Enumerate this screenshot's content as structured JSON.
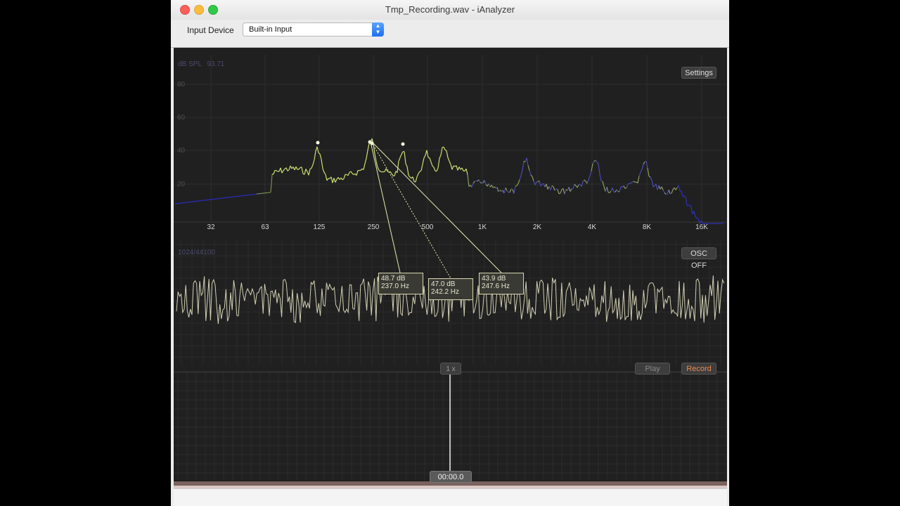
{
  "window": {
    "title": "Tmp_Recording.wav - iAnalyzer"
  },
  "toolbar": {
    "input_device_label": "Input Device",
    "input_device_value": "Built-in Input"
  },
  "spectrum": {
    "scale_label": "dB SPL",
    "spl_value": "93.71",
    "y_ticks": [
      "80",
      "60",
      "40",
      "20"
    ],
    "x_ticks": [
      "32",
      "63",
      "125",
      "250",
      "500",
      "1K",
      "2K",
      "4K",
      "8K",
      "16K"
    ],
    "settings_label": "Settings",
    "peaks": [
      {
        "db": "48.7 dB",
        "hz": "237.0 Hz"
      },
      {
        "db": "47.0 dB",
        "hz": "242.2 Hz"
      },
      {
        "db": "43.9 dB",
        "hz": "247.6 Hz"
      }
    ]
  },
  "oscilloscope": {
    "info_label": "1024/44100",
    "osc_toggle_label": "OSC OFF"
  },
  "transport": {
    "zoom_label": "1 x",
    "play_label": "Play",
    "record_label": "Record",
    "time": "00:00.0"
  }
}
